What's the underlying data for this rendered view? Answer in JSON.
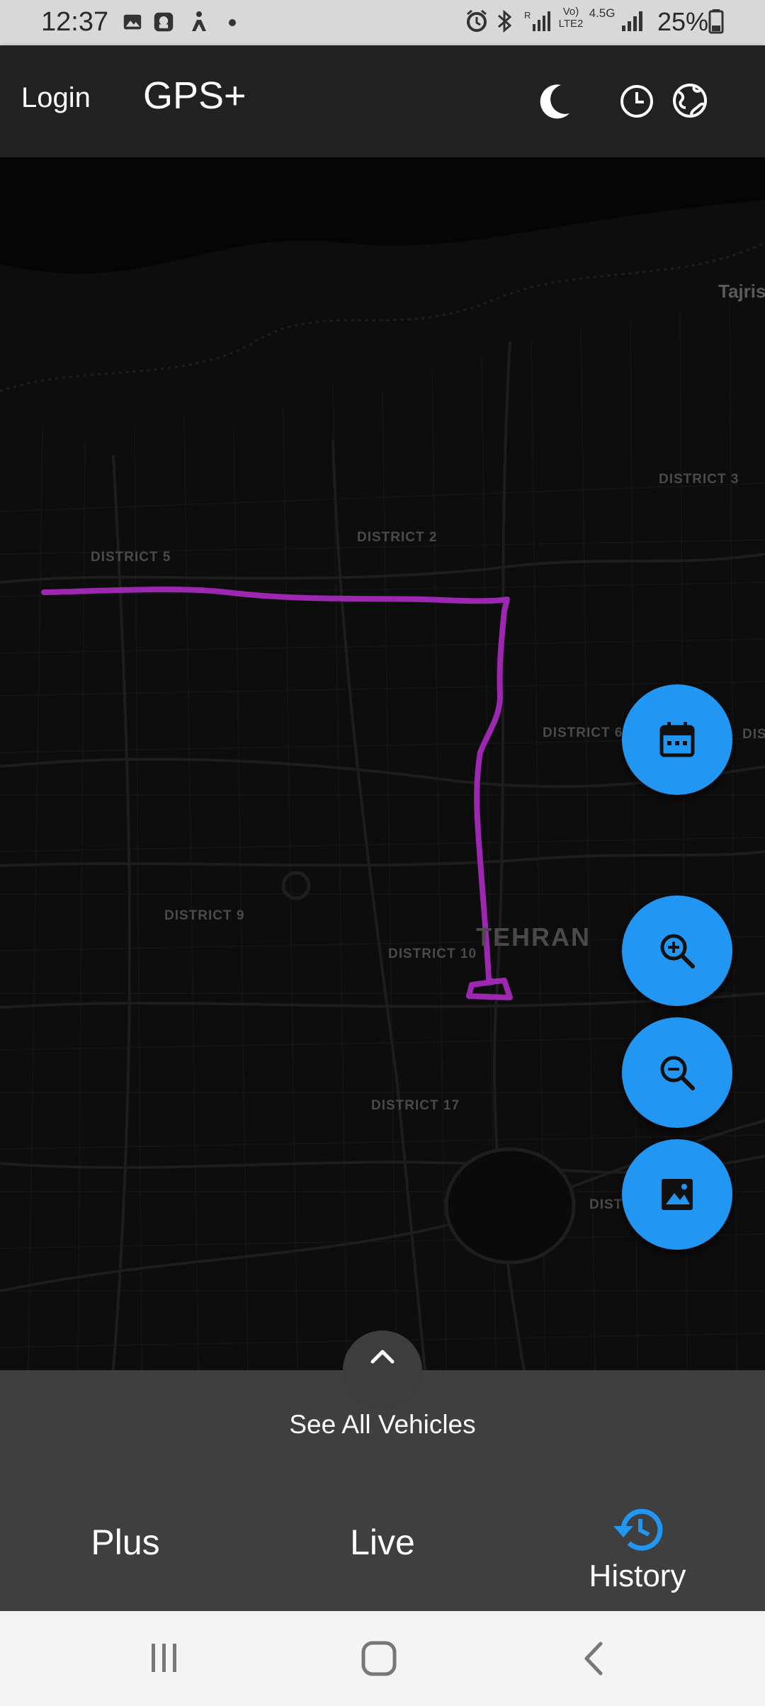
{
  "status_bar": {
    "time": "12:37",
    "battery": "25%",
    "network": "4.5G",
    "volte": "Vo) LTE2",
    "left_icons": [
      "image-icon",
      "app-icon",
      "accessibility-icon",
      "dot-icon"
    ],
    "right_icons": [
      "alarm-icon",
      "bluetooth-icon",
      "signal-icon",
      "volte-icon",
      "network-4-5g-icon",
      "signal-icon",
      "battery-icon"
    ]
  },
  "app_bar": {
    "login_label": "Login",
    "title": "GPS+",
    "icons": [
      "moon-icon",
      "clock-icon",
      "globe-icon"
    ]
  },
  "map": {
    "labels": {
      "district2": "DISTRICT 2",
      "district3": "DISTRICT 3",
      "district5": "DISTRICT 5",
      "district6": "DISTRICT 6",
      "district9": "DISTRICT 9",
      "district10": "DISTRICT 10",
      "district17": "DISTRICT 17",
      "city": "TEHRAN",
      "tajrish": "Tajris",
      "dis_fragment": "DIS",
      "dist_fragment": "DIST"
    },
    "route_color": "#9c27b0",
    "map_style": "dark"
  },
  "fabs": [
    {
      "name": "calendar",
      "icon": "calendar-icon"
    },
    {
      "name": "zoom-in",
      "icon": "zoom-in-icon"
    },
    {
      "name": "zoom-out",
      "icon": "zoom-out-icon"
    },
    {
      "name": "map-style",
      "icon": "image-icon"
    }
  ],
  "bottom_sheet": {
    "label": "See All Vehicles",
    "handle_icon": "chevron-up-icon"
  },
  "bottom_nav": {
    "items": [
      {
        "label": "Plus",
        "active": false
      },
      {
        "label": "Live",
        "active": false
      },
      {
        "label": "History",
        "active": true,
        "icon": "history-icon"
      }
    ]
  },
  "system_nav": {
    "icons": [
      "recents-icon",
      "home-icon",
      "back-icon"
    ]
  },
  "colors": {
    "accent": "#2196f3",
    "route": "#9c27b0",
    "app_bar": "#212121",
    "nav_bg": "#3f3f3f"
  }
}
